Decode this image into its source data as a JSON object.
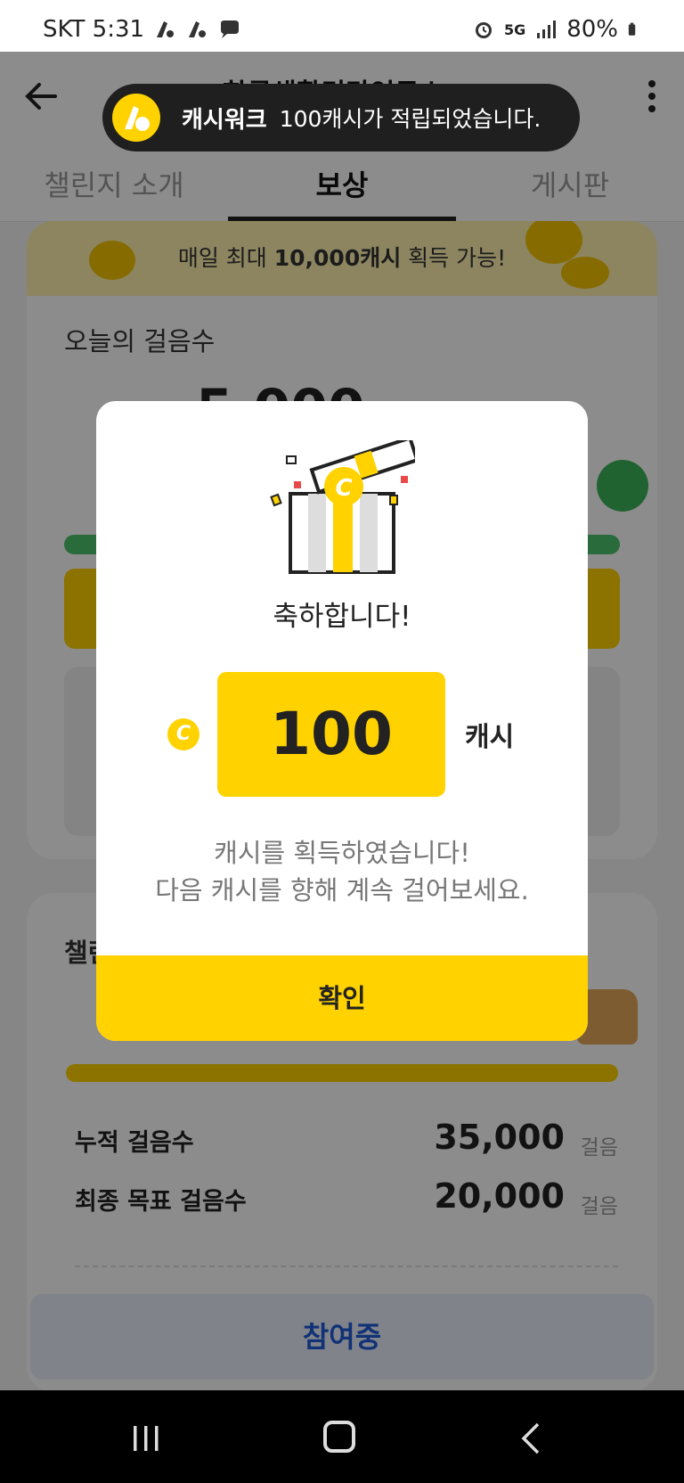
{
  "status_bar": {
    "carrier_time": "SKT 5:31",
    "network": "5G",
    "battery": "80%"
  },
  "app_bar": {
    "title_partial": "한국생활건강연구소",
    "tabs": [
      {
        "label": "챌린지 소개",
        "active": false
      },
      {
        "label": "보상",
        "active": true
      },
      {
        "label": "게시판",
        "active": false
      }
    ]
  },
  "toast": {
    "app_name": "캐시워크",
    "message": "100캐시가 적립되었습니다."
  },
  "reward_card": {
    "banner_prefix": "매일 최대 ",
    "banner_bold": "10,000캐시",
    "banner_suffix": " 획득 가능!",
    "today_steps_label": "오늘의 걸음수",
    "today_steps_partial": "5,000"
  },
  "challenge_card": {
    "title_partial": "챌린",
    "rows": [
      {
        "label": "누적 걸음수",
        "value": "35,000",
        "unit": "걸음"
      },
      {
        "label": "최종 목표 걸음수",
        "value": "20,000",
        "unit": "걸음"
      }
    ]
  },
  "join_button": "참여중",
  "modal": {
    "title": "축하합니다!",
    "coin_letter": "C",
    "amount": "100",
    "unit": "캐시",
    "message_line1": "캐시를 획득하였습니다!",
    "message_line2": "다음 캐시를 향해 계속 걸어보세요.",
    "confirm_label": "확인"
  },
  "colors": {
    "accent_yellow": "#ffd200",
    "overlay": "rgba(0,0,0,0.45)",
    "join_text": "#1f5bd8"
  }
}
